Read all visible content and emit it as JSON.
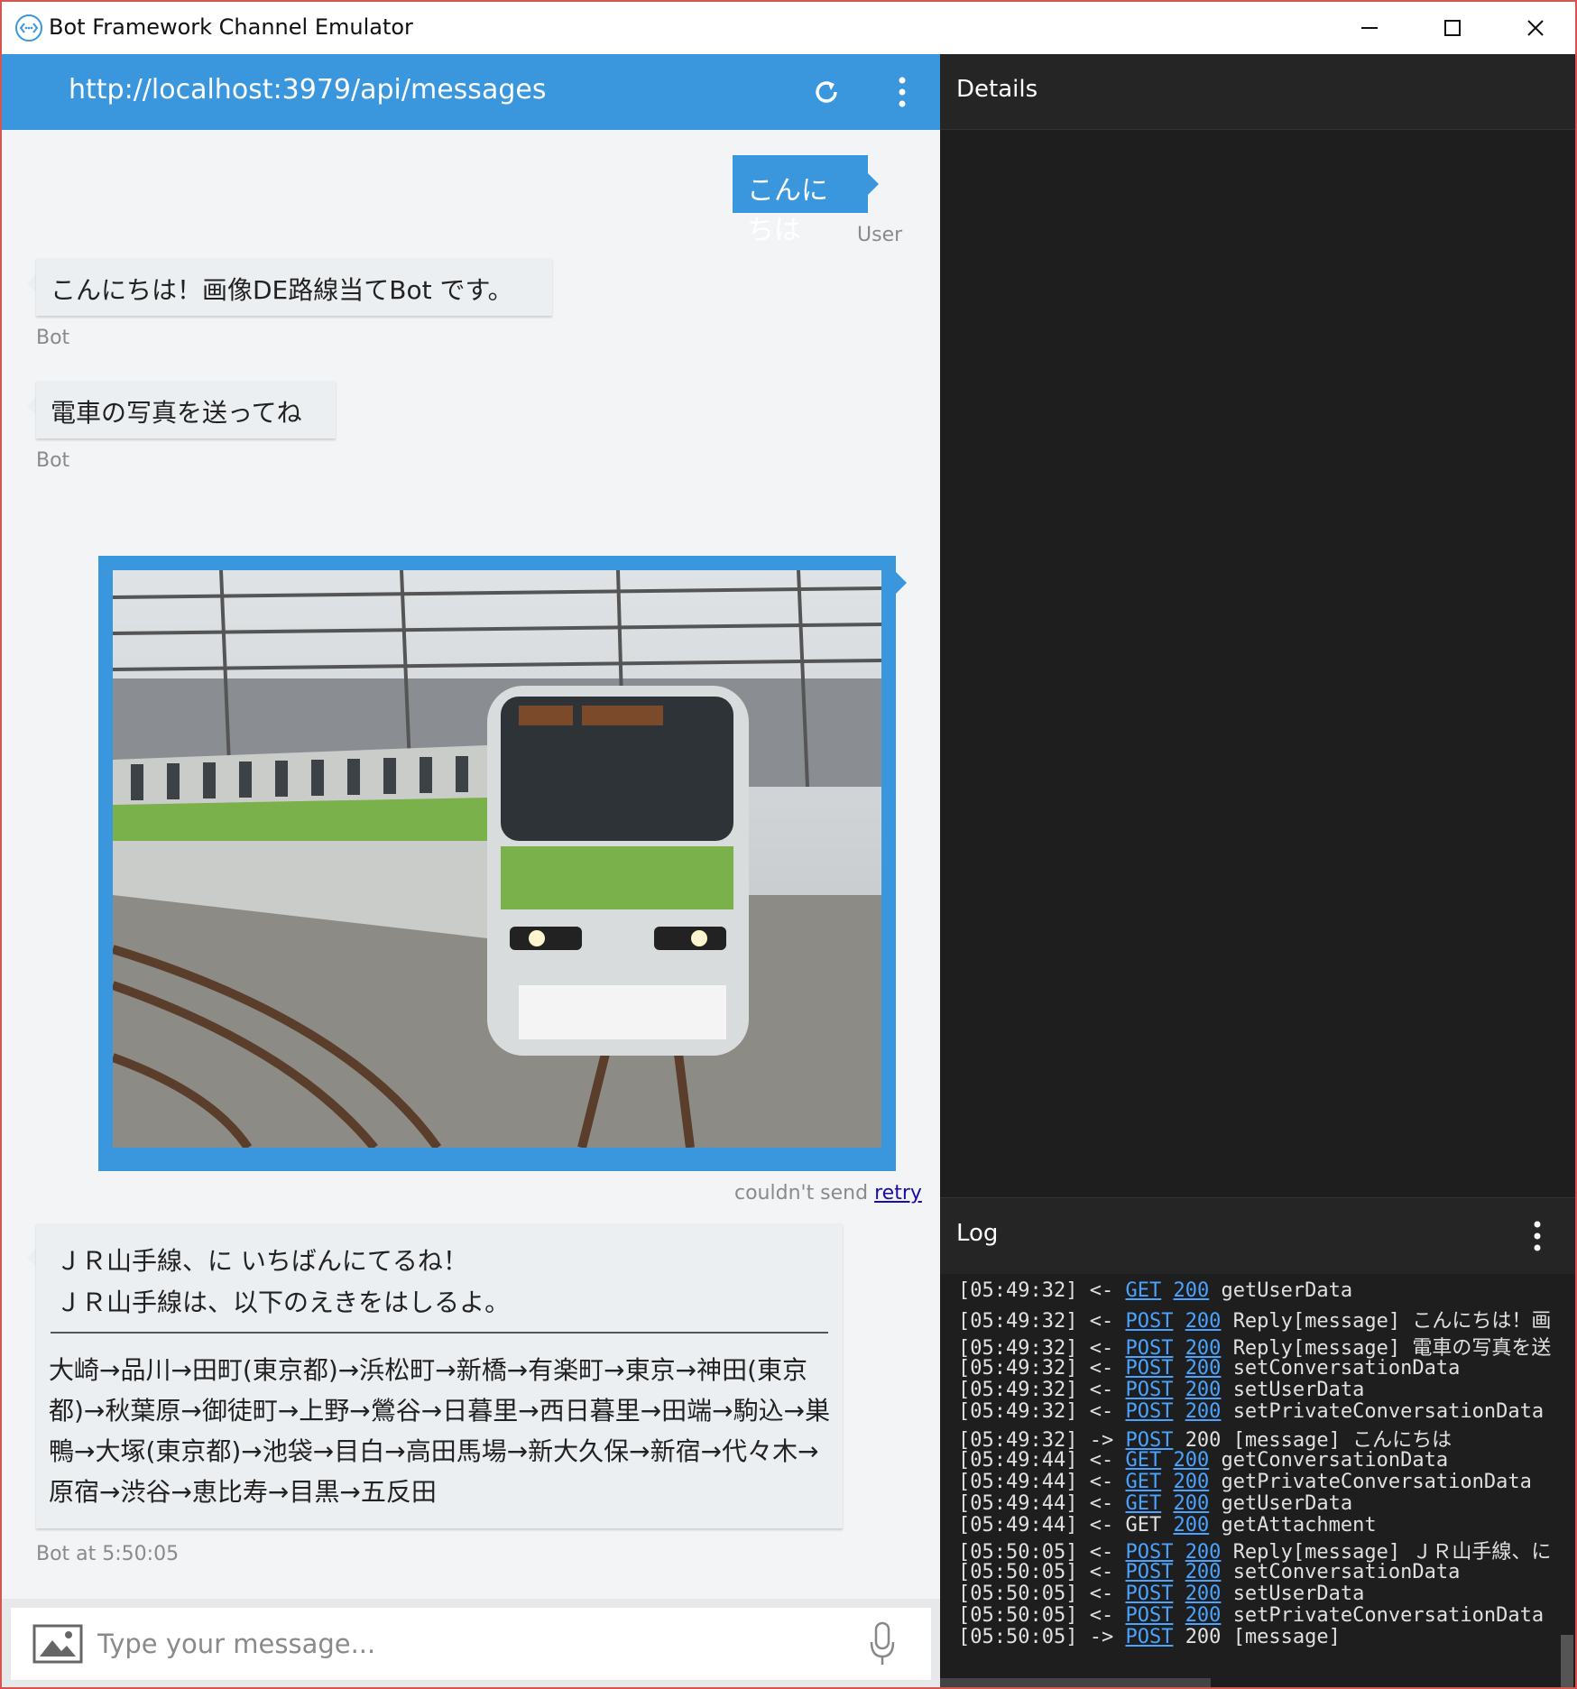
{
  "window": {
    "title": "Bot Framework Channel Emulator",
    "minimize_label": "—",
    "maximize_label": "☐",
    "close_label": "✕"
  },
  "chat": {
    "endpoint_url": "http://localhost:3979/api/messages",
    "messages": [
      {
        "from": "user",
        "text": "こんにちは",
        "caption": "User"
      },
      {
        "from": "bot",
        "text": "こんにちは！画像DE路線当てBot です。",
        "caption": "Bot"
      },
      {
        "from": "bot",
        "text": "電車の写真を送ってね",
        "caption": "Bot"
      },
      {
        "from": "user",
        "type": "image",
        "caption_prefix": "couldn't send ",
        "caption_link": "retry"
      },
      {
        "from": "bot",
        "line1": "ＪＲ山手線、に いちばんにてるね！",
        "line2": "ＪＲ山手線は、以下のえきをはしるよ。",
        "route": "大崎→品川→田町(東京都)→浜松町→新橋→有楽町→東京→神田(東京都)→秋葉原→御徒町→上野→鶯谷→日暮里→西日暮里→田端→駒込→巣鴨→大塚(東京都)→池袋→目白→高田馬場→新大久保→新宿→代々木→原宿→渋谷→恵比寿→目黒→五反田",
        "caption": "Bot at 5:50:05"
      }
    ],
    "input_placeholder": "Type your message..."
  },
  "details": {
    "title": "Details"
  },
  "log": {
    "title": "Log",
    "rows": [
      {
        "time": "[05:49:32]",
        "dir": "<-",
        "method": "GET",
        "method_link": true,
        "status": "200",
        "status_link": true,
        "text": "getUserData"
      },
      {
        "time": "[05:49:32]",
        "dir": "<-",
        "method": "POST",
        "method_link": true,
        "status": "200",
        "status_link": true,
        "text": "Reply[message] こんにちは！画"
      },
      {
        "time": "[05:49:32]",
        "dir": "<-",
        "method": "POST",
        "method_link": true,
        "status": "200",
        "status_link": true,
        "text": "Reply[message] 電車の写真を送"
      },
      {
        "time": "[05:49:32]",
        "dir": "<-",
        "method": "POST",
        "method_link": true,
        "status": "200",
        "status_link": true,
        "text": "setConversationData"
      },
      {
        "time": "[05:49:32]",
        "dir": "<-",
        "method": "POST",
        "method_link": true,
        "status": "200",
        "status_link": true,
        "text": "setUserData"
      },
      {
        "time": "[05:49:32]",
        "dir": "<-",
        "method": "POST",
        "method_link": true,
        "status": "200",
        "status_link": true,
        "text": "setPrivateConversationData"
      },
      {
        "time": "[05:49:32]",
        "dir": "->",
        "method": "POST",
        "method_link": true,
        "status": "200",
        "status_link": false,
        "text": "[message] こんにちは"
      },
      {
        "time": "[05:49:44]",
        "dir": "<-",
        "method": "GET",
        "method_link": true,
        "status": "200",
        "status_link": true,
        "text": "getConversationData"
      },
      {
        "time": "[05:49:44]",
        "dir": "<-",
        "method": "GET",
        "method_link": true,
        "status": "200",
        "status_link": true,
        "text": "getPrivateConversationData"
      },
      {
        "time": "[05:49:44]",
        "dir": "<-",
        "method": "GET",
        "method_link": true,
        "status": "200",
        "status_link": true,
        "text": "getUserData"
      },
      {
        "time": "[05:49:44]",
        "dir": "<-",
        "method": "GET",
        "method_link": false,
        "status": "200",
        "status_link": true,
        "text": "getAttachment"
      },
      {
        "time": "[05:50:05]",
        "dir": "<-",
        "method": "POST",
        "method_link": true,
        "status": "200",
        "status_link": true,
        "text": "Reply[message] ＪＲ山手線、に"
      },
      {
        "time": "[05:50:05]",
        "dir": "<-",
        "method": "POST",
        "method_link": true,
        "status": "200",
        "status_link": true,
        "text": "setConversationData"
      },
      {
        "time": "[05:50:05]",
        "dir": "<-",
        "method": "POST",
        "method_link": true,
        "status": "200",
        "status_link": true,
        "text": "setUserData"
      },
      {
        "time": "[05:50:05]",
        "dir": "<-",
        "method": "POST",
        "method_link": true,
        "status": "200",
        "status_link": true,
        "text": "setPrivateConversationData"
      },
      {
        "time": "[05:50:05]",
        "dir": "->",
        "method": "POST",
        "method_link": true,
        "status": "200",
        "status_link": false,
        "text": "[message]"
      }
    ]
  },
  "colors": {
    "accent": "#3a96dd",
    "link": "#4aa3ff",
    "dark_bg": "#1e1e1e"
  }
}
